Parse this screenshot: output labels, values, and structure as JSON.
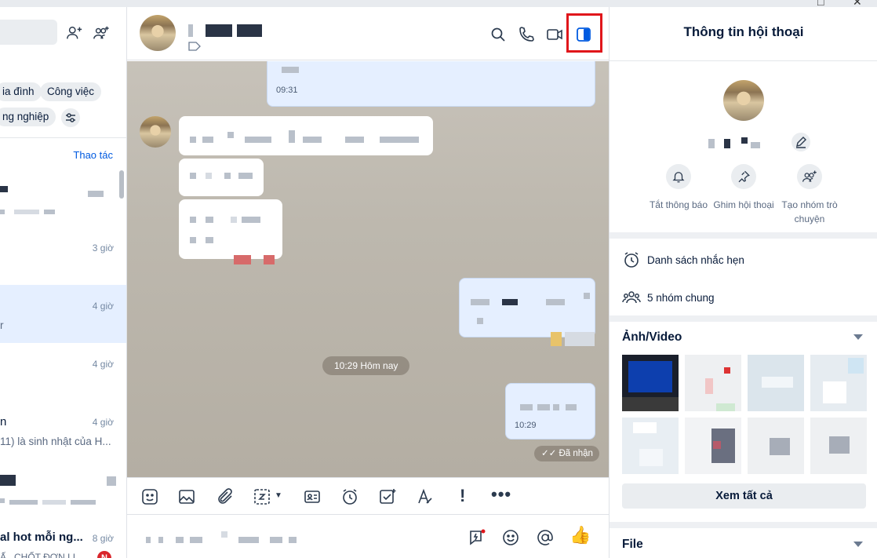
{
  "sidebar": {
    "filter_chips": [
      "ia đình",
      "Công việc",
      "ng nghiệp"
    ],
    "action_link": "Thao tác",
    "conversations": [
      {
        "time": "",
        "preview": ""
      },
      {
        "time": "3 giờ",
        "preview": ""
      },
      {
        "time": "4 giờ",
        "preview": "r"
      },
      {
        "time": "4 giờ",
        "preview": ""
      },
      {
        "time": "4 giờ",
        "name": "n",
        "preview": "11) là sinh nhật của H..."
      },
      {
        "time": "",
        "preview": ""
      },
      {
        "time": "8 giờ",
        "name": "al hot mỗi ng...",
        "preview": "Ấ...CHỐT ĐƠN LI..."
      }
    ],
    "unread_badge": "N"
  },
  "chat": {
    "messages": [
      {
        "time": "09:31"
      },
      {
        "time": "10:29"
      }
    ],
    "day_separator": "10:29 Hôm nay",
    "delivery_status": "Đã nhận"
  },
  "panel": {
    "title": "Thông tin hội thoại",
    "actions": [
      {
        "label": "Tắt thông báo",
        "icon": "bell-icon"
      },
      {
        "label": "Ghim hội thoại",
        "icon": "pin-icon"
      },
      {
        "label": "Tạo nhóm trò chuyện",
        "icon": "add-group-icon"
      }
    ],
    "reminders": "Danh sách nhắc hẹn",
    "common_groups": "5 nhóm chung",
    "media_title": "Ảnh/Video",
    "see_all": "Xem tất cả",
    "file_title": "File"
  },
  "colors": {
    "accent": "#005ae0",
    "highlight_box": "#e0161b",
    "active_row": "#e5efff"
  }
}
